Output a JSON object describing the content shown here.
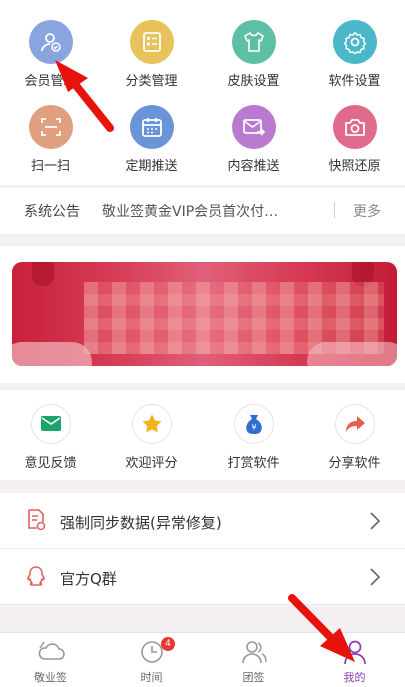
{
  "grid": [
    {
      "label": "会员管理",
      "icon": "member-icon",
      "color": "#8aa4e0"
    },
    {
      "label": "分类管理",
      "icon": "category-icon",
      "color": "#e8c25a"
    },
    {
      "label": "皮肤设置",
      "icon": "skin-icon",
      "color": "#5dbfa6"
    },
    {
      "label": "软件设置",
      "icon": "settings-icon",
      "color": "#4ab8c8"
    },
    {
      "label": "扫一扫",
      "icon": "scan-icon",
      "color": "#e0a080"
    },
    {
      "label": "定期推送",
      "icon": "calendar-icon",
      "color": "#6a94d8"
    },
    {
      "label": "内容推送",
      "icon": "send-mail-icon",
      "color": "#b97ad0"
    },
    {
      "label": "快照还原",
      "icon": "camera-icon",
      "color": "#e06a8a"
    }
  ],
  "notice": {
    "label": "系统公告",
    "message": "敬业签黄金VIP会员首次付…",
    "more": "更多"
  },
  "actions": [
    {
      "label": "意见反馈",
      "icon": "mail-icon",
      "color": "#1aa36a"
    },
    {
      "label": "欢迎评分",
      "icon": "star-icon",
      "color": "#f0b418"
    },
    {
      "label": "打赏软件",
      "icon": "money-bag-icon",
      "color": "#2f6fd0"
    },
    {
      "label": "分享软件",
      "icon": "share-arrow-icon",
      "color": "#e0604a"
    }
  ],
  "list": [
    {
      "label": "强制同步数据(异常修复)",
      "icon": "sync-doc-icon"
    },
    {
      "label": "官方Q群",
      "icon": "qq-icon"
    }
  ],
  "tabs": [
    {
      "label": "敬业签",
      "icon": "cloud-icon",
      "active": false
    },
    {
      "label": "时间",
      "icon": "clock-icon",
      "active": false,
      "badge": "4"
    },
    {
      "label": "团签",
      "icon": "team-icon",
      "active": false
    },
    {
      "label": "我的",
      "icon": "profile-icon",
      "active": true
    }
  ]
}
